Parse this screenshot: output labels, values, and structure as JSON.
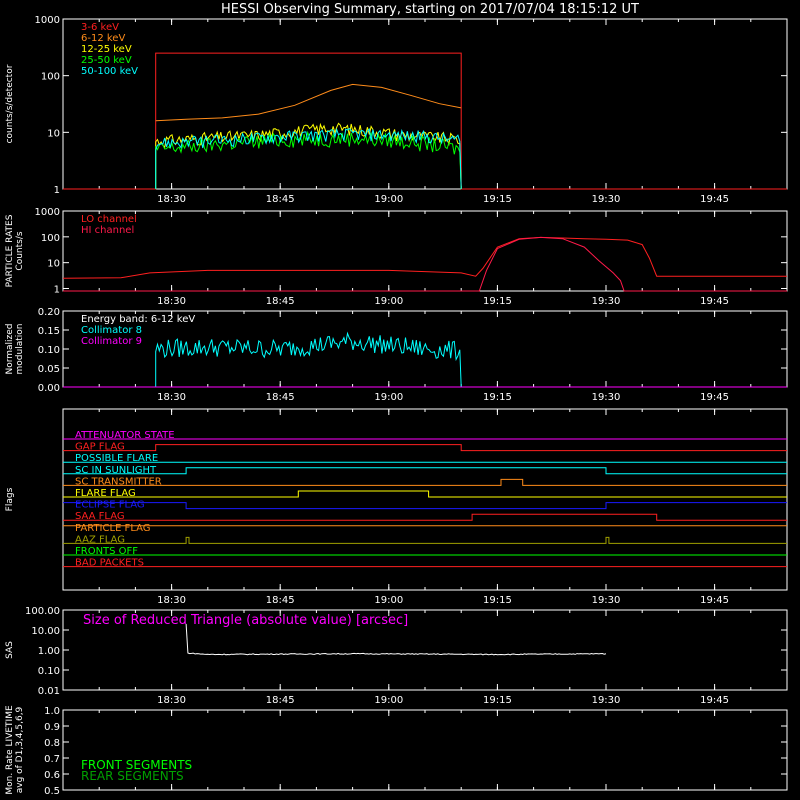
{
  "title": "HESSI Observing Summary, starting on 2017/07/04 18:15:12 UT",
  "time_ticks": [
    "18:30",
    "18:45",
    "19:00",
    "19:15",
    "19:30",
    "19:45"
  ],
  "time_ticks_min": [
    15,
    30,
    45,
    60,
    75,
    90
  ],
  "time_range_min": [
    0,
    100
  ],
  "colors": {
    "bg": "#000000",
    "axes": "#ffffff",
    "red": "#ff2020",
    "orange": "#ff8c1a",
    "yellow": "#ffff00",
    "green": "#00ff00",
    "cyan": "#00ffff",
    "magenta": "#ff00ff",
    "crimson": "#ff1a4a",
    "blue": "#1a1aff",
    "olive": "#a0a000",
    "white": "#ffffff",
    "darkgreen": "#00a000"
  },
  "chart_data": [
    {
      "id": "counts",
      "type": "line",
      "ylabel": "counts/s/detector",
      "scale": "log",
      "ylim": [
        1,
        1000
      ],
      "yticks": [
        "1",
        "10",
        "100",
        "1000"
      ],
      "legend": [
        {
          "name": "3-6 keV",
          "color": "red"
        },
        {
          "name": "6-12 keV",
          "color": "orange"
        },
        {
          "name": "12-25 keV",
          "color": "yellow"
        },
        {
          "name": "25-50 keV",
          "color": "green"
        },
        {
          "name": "50-100 keV",
          "color": "cyan"
        }
      ],
      "series": [
        {
          "name": "3-6 keV",
          "color": "red",
          "x": [
            0,
            12.8,
            12.8,
            55,
            55,
            100
          ],
          "y": [
            1,
            1,
            250,
            250,
            1,
            1
          ]
        },
        {
          "name": "6-12 keV",
          "color": "orange",
          "x": [
            12.8,
            17,
            22,
            27,
            32,
            37,
            40,
            44,
            48,
            52,
            55
          ],
          "y": [
            16,
            17,
            18,
            21,
            30,
            55,
            70,
            62,
            45,
            32,
            27
          ]
        },
        {
          "name": "12-25 keV",
          "color": "yellow",
          "x": [
            12.8,
            20,
            27,
            32,
            37,
            42,
            47,
            55
          ],
          "y": [
            7,
            8,
            9,
            10.5,
            12,
            11,
            9,
            7.5
          ],
          "noise": 0.25
        },
        {
          "name": "25-50 keV",
          "color": "green",
          "x": [
            12.8,
            20,
            30,
            40,
            50,
            55
          ],
          "y": [
            5,
            6,
            7.5,
            8,
            6.5,
            5
          ],
          "noise": 0.3
        },
        {
          "name": "50-100 keV",
          "color": "cyan",
          "x": [
            12.8,
            20,
            30,
            40,
            50,
            55
          ],
          "y": [
            6.5,
            7,
            8.5,
            9.5,
            8.5,
            7
          ],
          "noise": 0.25
        }
      ]
    },
    {
      "id": "particle",
      "type": "line",
      "ylabel": "PARTICLE RATES Counts/s",
      "scale": "log",
      "ylim": [
        0.8,
        1000
      ],
      "yticks": [
        "1",
        "10",
        "100",
        "1000"
      ],
      "legend": [
        {
          "name": "LO channel",
          "color": "red"
        },
        {
          "name": "HI channel",
          "color": "crimson"
        }
      ],
      "series": [
        {
          "name": "LO channel",
          "color": "red",
          "x": [
            0,
            8,
            12,
            20,
            30,
            45,
            55,
            57,
            58,
            60,
            63,
            66,
            69,
            72,
            75,
            78,
            80,
            81,
            82,
            100
          ],
          "y": [
            2.5,
            2.6,
            4,
            5,
            5,
            5,
            4,
            3,
            6,
            40,
            85,
            95,
            90,
            85,
            80,
            75,
            50,
            15,
            3,
            3
          ]
        },
        {
          "name": "HI channel",
          "color": "crimson",
          "x": [
            0,
            57.5,
            58.5,
            60,
            63,
            66,
            69,
            72,
            74,
            76,
            77,
            77.5,
            100
          ],
          "y": [
            0.8,
            0.8,
            5,
            35,
            80,
            95,
            85,
            40,
            12,
            4,
            2,
            0.8,
            0.8
          ]
        }
      ]
    },
    {
      "id": "modulation",
      "type": "line",
      "ylabel": "Normalized modulation",
      "scale": "linear",
      "ylim": [
        0,
        0.2
      ],
      "yticks": [
        "0.00",
        "0.05",
        "0.10",
        "0.15",
        "0.20"
      ],
      "legend": [
        {
          "name": "Energy band: 6-12 keV",
          "color": "white"
        },
        {
          "name": "Collimator 8",
          "color": "cyan"
        },
        {
          "name": "Collimator 9",
          "color": "magenta"
        }
      ],
      "series": [
        {
          "name": "Collimator 8",
          "color": "cyan",
          "x": [
            12.8,
            20,
            30,
            40,
            45,
            50,
            55
          ],
          "y": [
            0.1,
            0.105,
            0.1,
            0.12,
            0.11,
            0.1,
            0.095
          ],
          "noise": 0.025
        },
        {
          "name": "Collimator 9",
          "color": "magenta",
          "x": [
            0,
            100
          ],
          "y": [
            0,
            0
          ]
        }
      ]
    },
    {
      "id": "sas",
      "type": "line",
      "ylabel": "SAS",
      "scale": "log",
      "ylim": [
        0.01,
        100
      ],
      "yticks": [
        "0.01",
        "0.10",
        "1.00",
        "10.00",
        "100.00"
      ],
      "legend": [
        {
          "name": "Size of Reduced Triangle (absolute value) [arcsec]",
          "color": "magenta"
        }
      ],
      "series": [
        {
          "name": "SAS",
          "color": "white",
          "x": [
            17,
            17.2,
            20,
            40,
            60,
            75,
            75.2
          ],
          "y": [
            20,
            0.7,
            0.6,
            0.65,
            0.6,
            0.65,
            60
          ],
          "noise": 0.05
        }
      ]
    }
  ],
  "flags": {
    "ylabel": "Flags",
    "items": [
      {
        "name": "ATTENUATOR STATE",
        "color": "magenta",
        "segments": [
          [
            0,
            100,
            0
          ]
        ]
      },
      {
        "name": "GAP FLAG",
        "color": "red",
        "segments": [
          [
            0,
            12.8,
            0
          ],
          [
            12.8,
            55,
            1
          ],
          [
            55,
            100,
            0
          ]
        ]
      },
      {
        "name": "POSSIBLE FLARE",
        "color": "cyan",
        "segments": [
          [
            0,
            100,
            0
          ]
        ]
      },
      {
        "name": "SC IN SUNLIGHT",
        "color": "cyan",
        "segments": [
          [
            0,
            17,
            0
          ],
          [
            17,
            75,
            1
          ],
          [
            75,
            100,
            0
          ]
        ]
      },
      {
        "name": "SC TRANSMITTER",
        "color": "orange",
        "segments": [
          [
            0,
            60.5,
            0
          ],
          [
            60.5,
            63.5,
            1
          ],
          [
            63.5,
            100,
            0
          ]
        ]
      },
      {
        "name": "FLARE FLAG",
        "color": "yellow",
        "segments": [
          [
            0,
            32.5,
            0
          ],
          [
            32.5,
            50.5,
            1
          ],
          [
            50.5,
            100,
            0
          ]
        ]
      },
      {
        "name": "ECLIPSE FLAG",
        "color": "blue",
        "segments": [
          [
            0,
            17,
            1
          ],
          [
            17,
            75,
            0
          ],
          [
            75,
            100,
            1
          ]
        ]
      },
      {
        "name": "SAA FLAG",
        "color": "red",
        "segments": [
          [
            0,
            56.5,
            0
          ],
          [
            56.5,
            82,
            1
          ],
          [
            82,
            100,
            0
          ]
        ]
      },
      {
        "name": "PARTICLE FLAG",
        "color": "orange",
        "segments": [
          [
            0,
            100,
            1
          ]
        ]
      },
      {
        "name": "AAZ FLAG",
        "color": "olive",
        "segments": [
          [
            0,
            17,
            0
          ],
          [
            17,
            17.4,
            1
          ],
          [
            17.4,
            75,
            0
          ],
          [
            75,
            75.4,
            1
          ],
          [
            75.4,
            100,
            0
          ]
        ]
      },
      {
        "name": "FRONTS OFF",
        "color": "green",
        "segments": [
          [
            0,
            100,
            0
          ]
        ]
      },
      {
        "name": "BAD PACKETS",
        "color": "red",
        "segments": [
          [
            0,
            100,
            0
          ]
        ]
      }
    ]
  },
  "livetime": {
    "ylabel": "Mon. Rate LIVETIME avg of D1,3,4,5,6,9",
    "yticks": [
      "0.5",
      "0.6",
      "0.7",
      "0.8",
      "0.9",
      "1.0"
    ],
    "ylim": [
      0.5,
      1.0
    ],
    "legend": [
      {
        "name": "FRONT SEGMENTS",
        "color": "green"
      },
      {
        "name": "REAR SEGMENTS",
        "color": "darkgreen"
      }
    ]
  }
}
